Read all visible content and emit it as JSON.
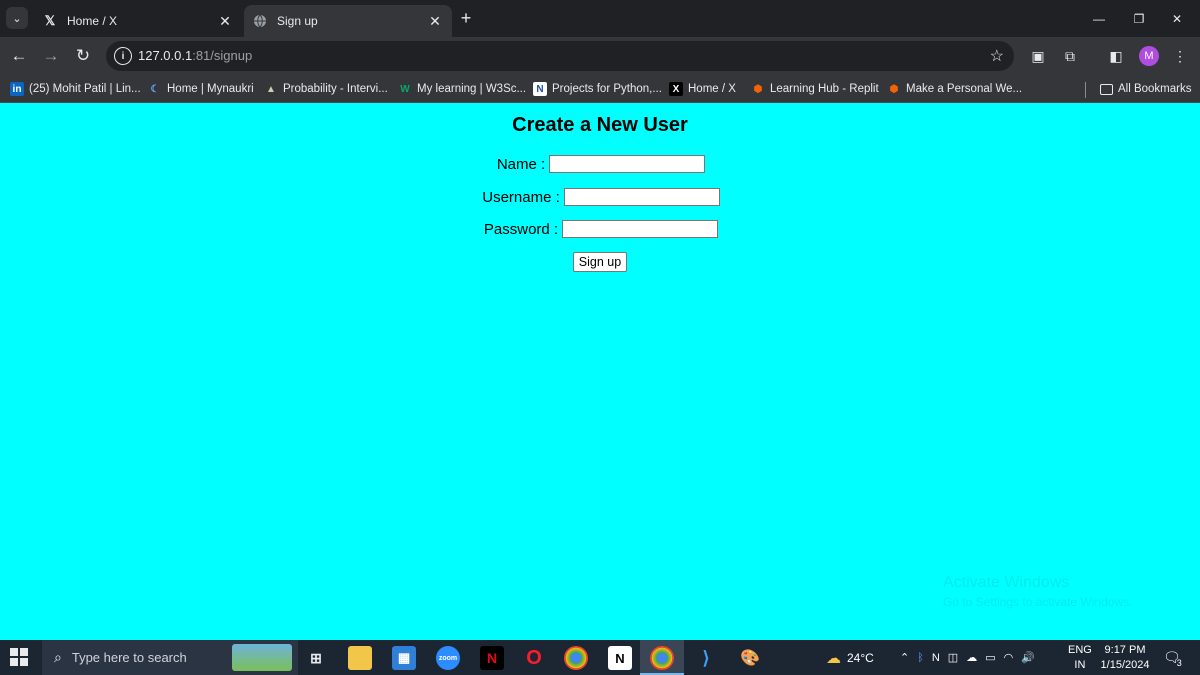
{
  "browser": {
    "tabs": [
      {
        "title": "Home / X",
        "favicon": "x-logo-icon",
        "active": false
      },
      {
        "title": "Sign up",
        "favicon": "globe-icon",
        "active": true
      }
    ],
    "url_host": "127.0.0.1",
    "url_rest": ":81/signup",
    "profile_initial": "M",
    "bookmarks": [
      {
        "label": "(25) Mohit Patil | Lin...",
        "icon": "in"
      },
      {
        "label": "Home | Mynaukri",
        "icon": "☾"
      },
      {
        "label": "Probability - Intervi...",
        "icon": "▲"
      },
      {
        "label": "My learning | W3Sc...",
        "icon": "W"
      },
      {
        "label": "Projects for Python,...",
        "icon": "N"
      },
      {
        "label": "Home / X",
        "icon": "X"
      },
      {
        "label": "Learning Hub - Replit",
        "icon": "⬢"
      },
      {
        "label": "Make a Personal We...",
        "icon": "⬢"
      }
    ],
    "all_bookmarks": "All Bookmarks"
  },
  "page": {
    "heading": "Create a New User",
    "fields": {
      "name_label": "Name :",
      "username_label": "Username :",
      "password_label": "Password :",
      "name_value": "",
      "username_value": "",
      "password_value": ""
    },
    "submit_label": "Sign up",
    "watermark_line1": "Activate Windows",
    "watermark_line2": "Go to Settings to activate Windows."
  },
  "taskbar": {
    "search_placeholder": "Type here to search",
    "weather": "24°C",
    "lang_line1": "ENG",
    "lang_line2": "IN",
    "time": "9:17 PM",
    "date": "1/15/2024",
    "notifications": "3"
  },
  "colors": {
    "page_bg": "#00ffff",
    "chrome_dark": "#202124",
    "chrome_toolbar": "#35363a",
    "taskbar": "#1c2633"
  }
}
